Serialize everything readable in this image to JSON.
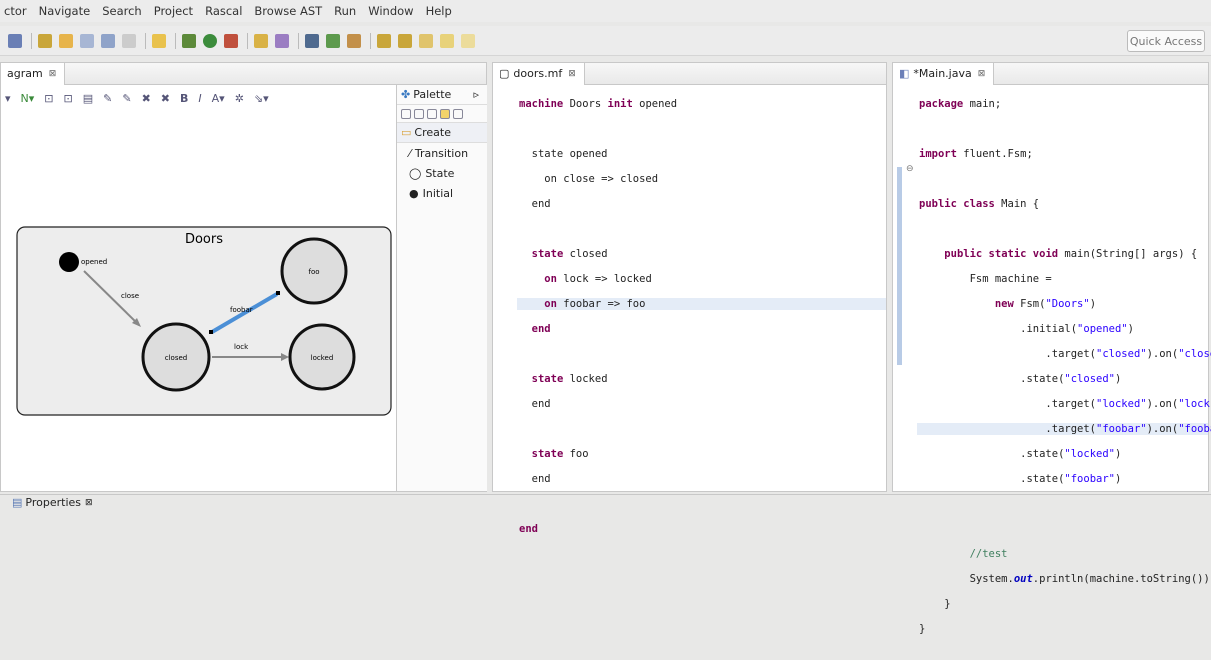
{
  "menu": [
    "ctor",
    "Navigate",
    "Search",
    "Project",
    "Rascal",
    "Browse AST",
    "Run",
    "Window",
    "Help"
  ],
  "quick_access": "Quick Access",
  "diagram": {
    "tab_label": "agram",
    "tab_close": "⊠",
    "palette_title": "Palette",
    "palette_group": "Create",
    "palette_items": [
      {
        "label": "Transition",
        "icon": "transition-icon"
      },
      {
        "label": "State",
        "icon": "state-icon"
      },
      {
        "label": "Initial",
        "icon": "initial-icon"
      }
    ],
    "machine_name": "Doors",
    "states": [
      "opened",
      "foo",
      "closed",
      "locked"
    ],
    "transitions": [
      "close",
      "foobar",
      "lock"
    ]
  },
  "mf_editor": {
    "tab_label": "doors.mf",
    "tab_close": "⊠"
  },
  "java_editor": {
    "tab_label": "*Main.java",
    "tab_close": "⊠"
  },
  "bottom": {
    "tab_label": "Properties",
    "tab_close": "⊠"
  }
}
